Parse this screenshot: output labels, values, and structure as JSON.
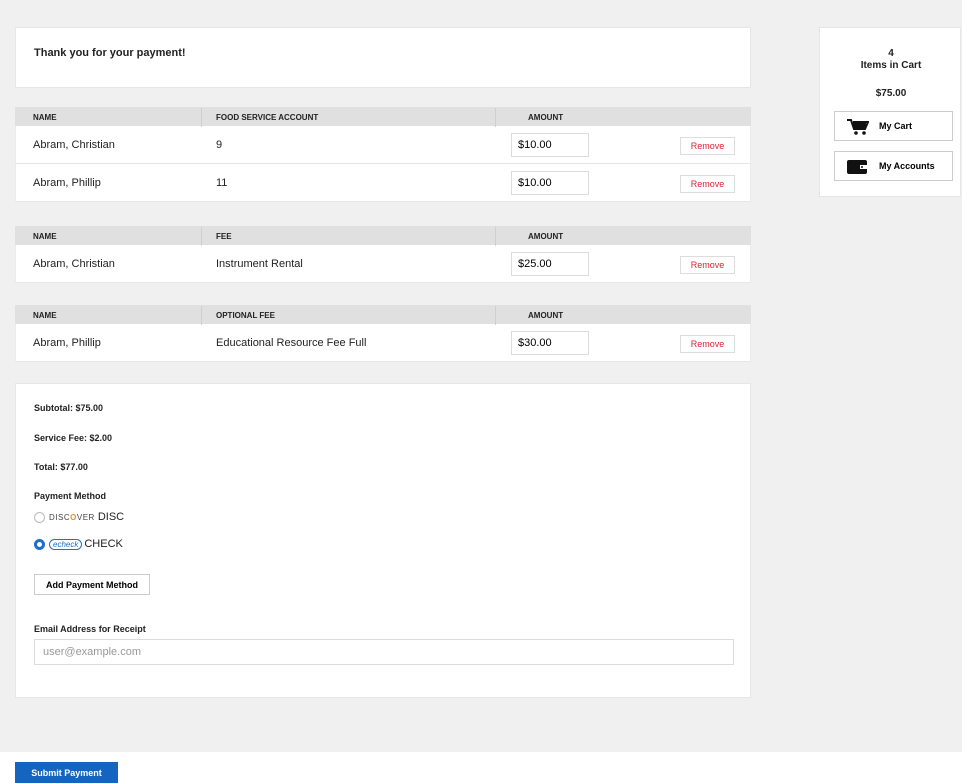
{
  "thank_you": "Thank you for your payment!",
  "tables": [
    {
      "headers": [
        "NAME",
        "FOOD SERVICE ACCOUNT",
        "AMOUNT"
      ],
      "rows": [
        {
          "name": "Abram, Christian",
          "value": "9",
          "amount": "$10.00",
          "action": "Remove"
        },
        {
          "name": "Abram, Phillip",
          "value": "11",
          "amount": "$10.00",
          "action": "Remove"
        }
      ]
    },
    {
      "headers": [
        "NAME",
        "FEE",
        "AMOUNT"
      ],
      "rows": [
        {
          "name": "Abram, Christian",
          "value": "Instrument Rental",
          "amount": "$25.00",
          "action": "Remove"
        }
      ]
    },
    {
      "headers": [
        "NAME",
        "OPTIONAL FEE",
        "AMOUNT"
      ],
      "rows": [
        {
          "name": "Abram, Phillip",
          "value": "Educational Resource Fee Full",
          "amount": "$30.00",
          "action": "Remove"
        }
      ]
    }
  ],
  "summary": {
    "subtotal": "Subtotal: $75.00",
    "service_fee": "Service Fee: $2.00",
    "total": "Total: $77.00",
    "payment_method_label": "Payment Method",
    "methods": [
      {
        "logo": "DISCOVER",
        "label": "DISC",
        "selected": false
      },
      {
        "logo": "echeck",
        "label": "CHECK",
        "selected": true
      }
    ],
    "add_payment_method": "Add Payment Method",
    "email_label": "Email Address for Receipt",
    "email_placeholder": "user@example.com"
  },
  "cart": {
    "count": "4",
    "count_label": "Items in Cart",
    "total": "$75.00",
    "my_cart": "My Cart",
    "my_accounts": "My Accounts",
    "icons": [
      "cart-icon",
      "wallet-icon"
    ]
  },
  "submit_label": "Submit Payment",
  "colors": {
    "primary": "#1565c0",
    "remove": "#dd2233",
    "header_bg": "#e0e0e0",
    "page_bg": "#f0f0f0"
  }
}
